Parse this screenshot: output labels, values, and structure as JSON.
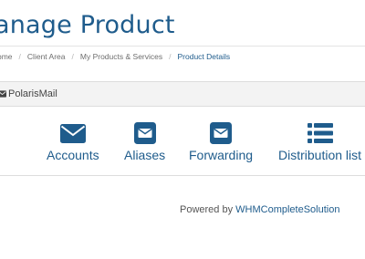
{
  "page": {
    "title": "anage Product"
  },
  "breadcrumb": {
    "items": [
      "ome",
      "Client Area",
      "My Products & Services"
    ],
    "separator": "/",
    "current": "Product Details"
  },
  "panel": {
    "header_title": "PolarisMail",
    "header_icon": "envelope-icon"
  },
  "tiles": [
    {
      "label": "Accounts",
      "icon": "envelope-icon"
    },
    {
      "label": "Aliases",
      "icon": "envelope-square-icon"
    },
    {
      "label": "Forwarding",
      "icon": "envelope-square-icon"
    },
    {
      "label": "Distribution list",
      "icon": "list-icon"
    }
  ],
  "footer": {
    "powered_prefix": "Powered by",
    "powered_link": "WHMCompleteSolution"
  },
  "colors": {
    "accent": "#1f5c8c",
    "panel_header_bg": "#f3f3f3",
    "text_muted": "#6e6e6e"
  }
}
